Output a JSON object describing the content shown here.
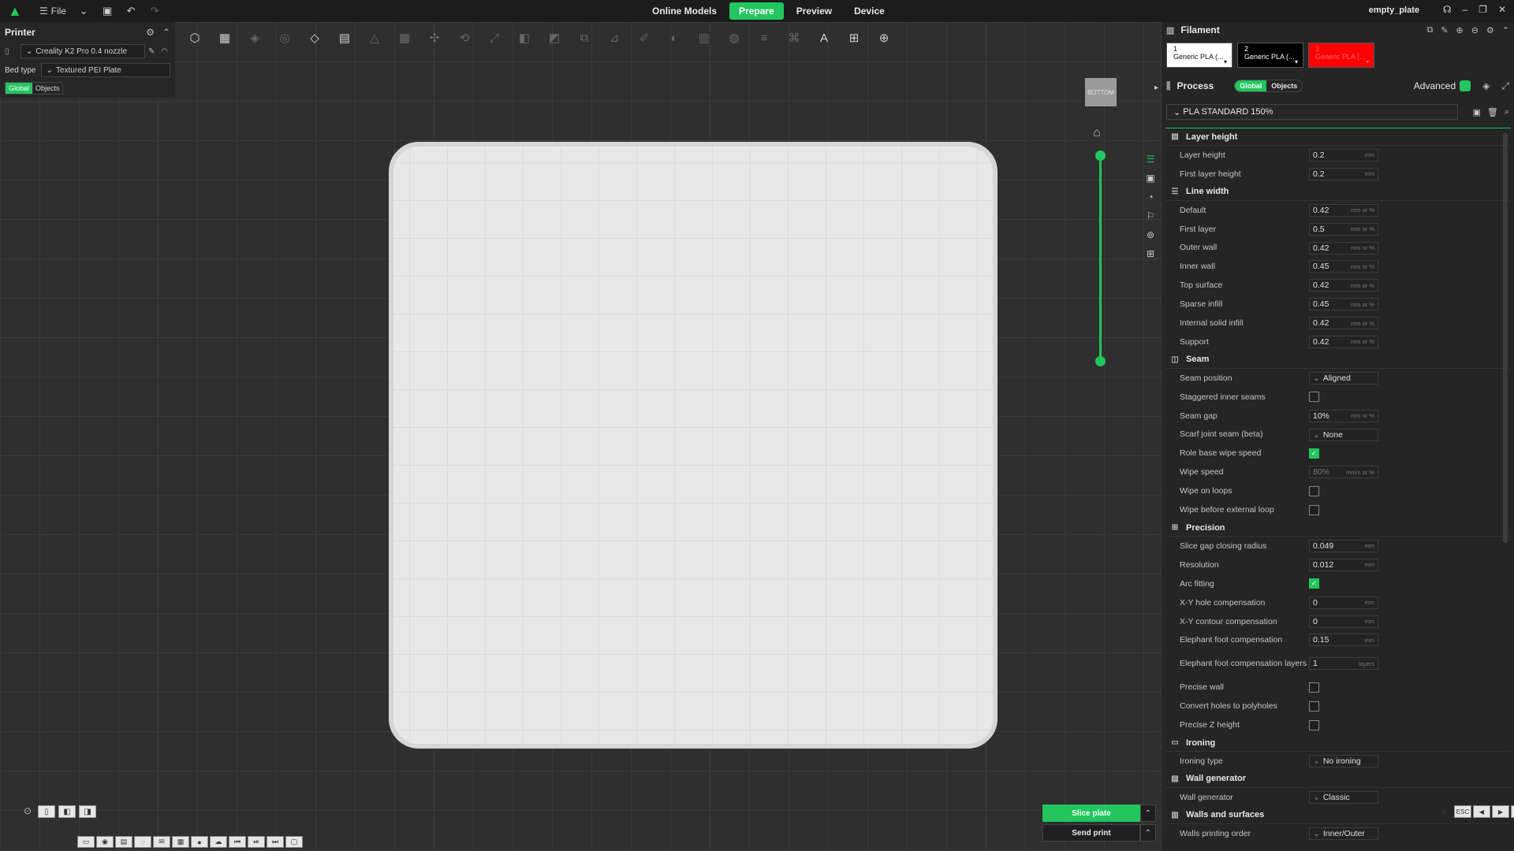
{
  "topbar": {
    "file_label": "File",
    "tabs": [
      "Online Models",
      "Prepare",
      "Preview",
      "Device"
    ],
    "active_tab": "Prepare",
    "window_title": "empty_plate"
  },
  "printer": {
    "title": "Printer",
    "printer_name": "Creality K2 Pro 0.4 nozzle",
    "bed_type_label": "Bed type",
    "bed_type_value": "Textured PEI Plate",
    "mode_global": "Global",
    "mode_objects": "Objects"
  },
  "viewport": {
    "cube_label": "BOTTOM",
    "slider_level": 1.0
  },
  "actions": {
    "slice_label": "Slice plate",
    "send_label": "Send print"
  },
  "filament": {
    "title": "Filament",
    "slots": [
      {
        "num": "1",
        "name": "Generic PLA (...",
        "color": "#ffffff"
      },
      {
        "num": "2",
        "name": "Generic PLA (...",
        "color": "#000000"
      },
      {
        "num": "3",
        "name": "Generic PLA (...",
        "color": "#ff0000"
      }
    ]
  },
  "process": {
    "title": "Process",
    "mode_global": "Global",
    "mode_objects": "Objects",
    "advanced_label": "Advanced",
    "preset": "PLA STANDARD 150%",
    "sections": [
      {
        "title": "Layer height",
        "rows": [
          {
            "label": "Layer height",
            "type": "num",
            "value": "0.2",
            "unit": "mm"
          },
          {
            "label": "First layer height",
            "type": "num",
            "value": "0.2",
            "unit": "mm"
          }
        ]
      },
      {
        "title": "Line width",
        "rows": [
          {
            "label": "Default",
            "type": "num",
            "value": "0.42",
            "unit": "mm or %"
          },
          {
            "label": "First layer",
            "type": "num",
            "value": "0.5",
            "unit": "mm or %"
          },
          {
            "label": "Outer wall",
            "type": "num",
            "value": "0.42",
            "unit": "mm or %"
          },
          {
            "label": "Inner wall",
            "type": "num",
            "value": "0.45",
            "unit": "mm or %"
          },
          {
            "label": "Top surface",
            "type": "num",
            "value": "0.42",
            "unit": "mm or %"
          },
          {
            "label": "Sparse infill",
            "type": "num",
            "value": "0.45",
            "unit": "mm or %"
          },
          {
            "label": "Internal solid infill",
            "type": "num",
            "value": "0.42",
            "unit": "mm or %"
          },
          {
            "label": "Support",
            "type": "num",
            "value": "0.42",
            "unit": "mm or %"
          }
        ]
      },
      {
        "title": "Seam",
        "rows": [
          {
            "label": "Seam position",
            "type": "combo",
            "value": "Aligned"
          },
          {
            "label": "Staggered inner seams",
            "type": "check",
            "checked": false
          },
          {
            "label": "Seam gap",
            "type": "num",
            "value": "10%",
            "unit": "mm or %"
          },
          {
            "label": "Scarf joint seam (beta)",
            "type": "combo",
            "value": "None"
          },
          {
            "label": "Role base wipe speed",
            "type": "check",
            "checked": true
          },
          {
            "label": "Wipe speed",
            "type": "num",
            "value": "80%",
            "unit": "mm/s or %",
            "disabled": true
          },
          {
            "label": "Wipe on loops",
            "type": "check",
            "checked": false
          },
          {
            "label": "Wipe before external loop",
            "type": "check",
            "checked": false
          }
        ]
      },
      {
        "title": "Precision",
        "rows": [
          {
            "label": "Slice gap closing radius",
            "type": "num",
            "value": "0.049",
            "unit": "mm"
          },
          {
            "label": "Resolution",
            "type": "num",
            "value": "0.012",
            "unit": "mm"
          },
          {
            "label": "Arc fitting",
            "type": "check",
            "checked": true
          },
          {
            "label": "X-Y hole compensation",
            "type": "num",
            "value": "0",
            "unit": "mm"
          },
          {
            "label": "X-Y contour compensation",
            "type": "num",
            "value": "0",
            "unit": "mm"
          },
          {
            "label": "Elephant foot compensation",
            "type": "num",
            "value": "0.15",
            "unit": "mm"
          },
          {
            "label": "Elephant foot compensation layers",
            "type": "num",
            "value": "1",
            "unit": "layers",
            "tall": true
          },
          {
            "label": "Precise wall",
            "type": "check",
            "checked": false
          },
          {
            "label": "Convert holes to polyholes",
            "type": "check",
            "checked": false
          },
          {
            "label": "Precise Z height",
            "type": "check",
            "checked": false
          }
        ]
      },
      {
        "title": "Ironing",
        "rows": [
          {
            "label": "Ironing type",
            "type": "combo",
            "value": "No ironing"
          }
        ]
      },
      {
        "title": "Wall generator",
        "rows": [
          {
            "label": "Wall generator",
            "type": "combo",
            "value": "Classic"
          }
        ]
      },
      {
        "title": "Walls and surfaces",
        "rows": [
          {
            "label": "Walls printing order",
            "type": "combo",
            "value": "Inner/Outer"
          }
        ]
      }
    ]
  }
}
